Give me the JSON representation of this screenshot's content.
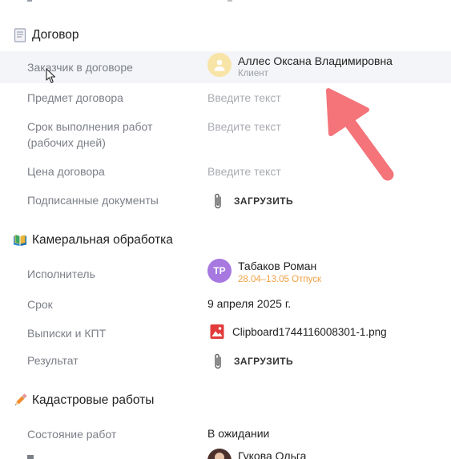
{
  "sections": [
    {
      "title": "Договор",
      "icon": "document-icon",
      "rows": [
        {
          "label": "Заказчик в договоре",
          "person": {
            "name": "Аллес Оксана Владимировна",
            "sub": "Клиент"
          }
        },
        {
          "label": "Предмет договора",
          "placeholder": "Введите текст"
        },
        {
          "label": "Срок выполнения работ (рабочих дней)",
          "placeholder": "Введите текст"
        },
        {
          "label": "Цена договора",
          "placeholder": "Введите текст"
        },
        {
          "label": "Подписанные документы",
          "upload": "ЗАГРУЗИТЬ"
        }
      ]
    },
    {
      "title": "Камеральная обработка",
      "icon": "open-book-icon",
      "rows": [
        {
          "label": "Исполнитель",
          "person": {
            "initials": "ТР",
            "name": "Табаков Роман",
            "sub": "28.04–13.05 Отпуск"
          }
        },
        {
          "label": "Срок",
          "value": "9 апреля 2025 г."
        },
        {
          "label": "Выписки и КПТ",
          "file": "Clipboard1744116008301-1.png"
        },
        {
          "label": "Результат",
          "upload": "ЗАГРУЗИТЬ"
        }
      ]
    },
    {
      "title": "Кадастровые работы",
      "icon": "pencil-icon",
      "rows": [
        {
          "label": "Состояние работ",
          "value": "В ожидании"
        },
        {
          "person": {
            "name": "Гукова Ольга"
          }
        }
      ]
    }
  ],
  "colors": {
    "accent_arrow": "#f4747a",
    "client_avatar_bg": "#f9e4a8",
    "tr_avatar_bg": "#a678e0",
    "vacation_text": "#f0a043",
    "image_file_icon": "#e23b3b"
  }
}
